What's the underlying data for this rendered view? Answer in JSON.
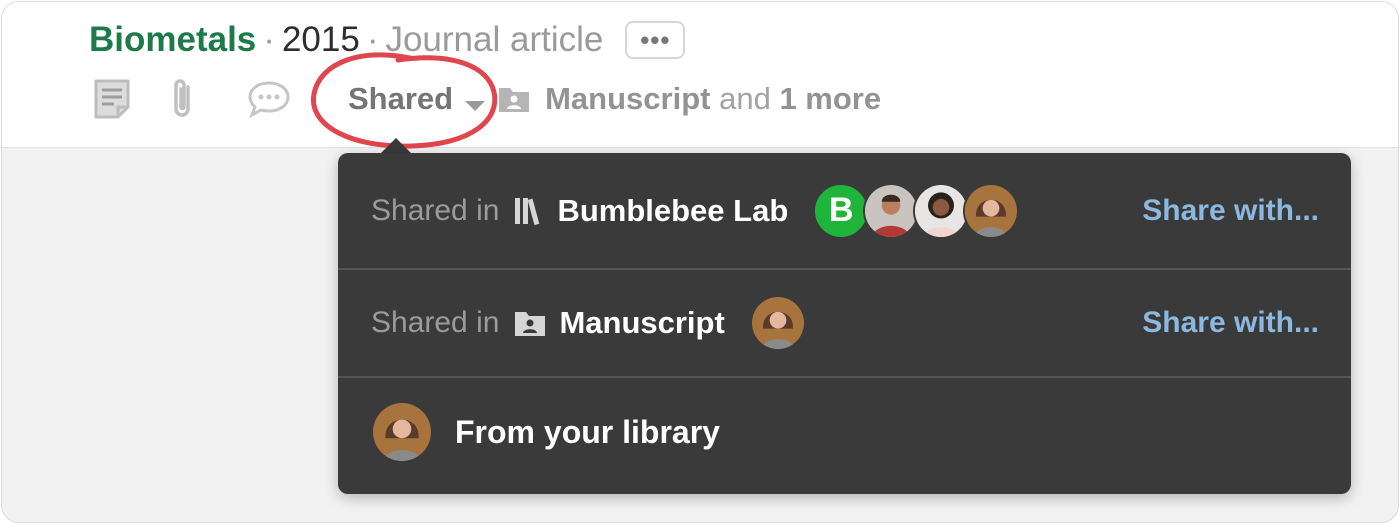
{
  "header": {
    "journal": "Biometals",
    "separator": "·",
    "year": "2015",
    "type": "Journal article",
    "more_label": "•••"
  },
  "toolbar": {
    "icons": [
      "notes-icon",
      "attachment-icon",
      "comment-icon"
    ],
    "shared_label": "Shared",
    "folder_name": "Manuscript",
    "and_text": "and",
    "more_text": "1 more"
  },
  "popover": {
    "rows": [
      {
        "prefix": "Shared in",
        "icon": "library-icon",
        "name": "Bumblebee Lab",
        "avatar_letter": "B",
        "action": "Share with..."
      },
      {
        "prefix": "Shared in",
        "icon": "folder-person-icon",
        "name": "Manuscript",
        "action": "Share with..."
      },
      {
        "text": "From your library"
      }
    ]
  },
  "colors": {
    "journal": "#1f7a4a",
    "popover_bg": "#3a3a3a",
    "link": "#8ab8e0",
    "annotation": "#e0464e",
    "badge": "#1fb53a"
  }
}
